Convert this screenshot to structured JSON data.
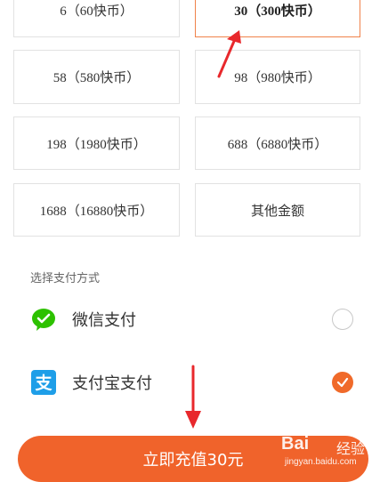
{
  "recharge_options": [
    {
      "label": "6（60快币）"
    },
    {
      "label": "30（300快币）",
      "selected": true
    },
    {
      "label": "58（580快币）"
    },
    {
      "label": "98（980快币）"
    },
    {
      "label": "198（1980快币）"
    },
    {
      "label": "688（6880快币）"
    },
    {
      "label": "1688（16880快币）"
    },
    {
      "label": "其他金额"
    }
  ],
  "payment": {
    "section_title": "选择支付方式",
    "methods": [
      {
        "label": "微信支付",
        "icon": "wechat-pay-icon",
        "selected": false
      },
      {
        "label": "支付宝支付",
        "icon": "alipay-icon",
        "selected": true
      }
    ]
  },
  "cta": {
    "label": "立即充值30元"
  },
  "watermark": {
    "logo": "Bai",
    "logo_cn": "经验",
    "url": "jingyan.baidu.com"
  },
  "colors": {
    "accent": "#f0632b",
    "selected_border": "#f0824a",
    "wechat": "#2dc100",
    "alipay": "#1e9ee8",
    "annotation": "#e8282c"
  }
}
